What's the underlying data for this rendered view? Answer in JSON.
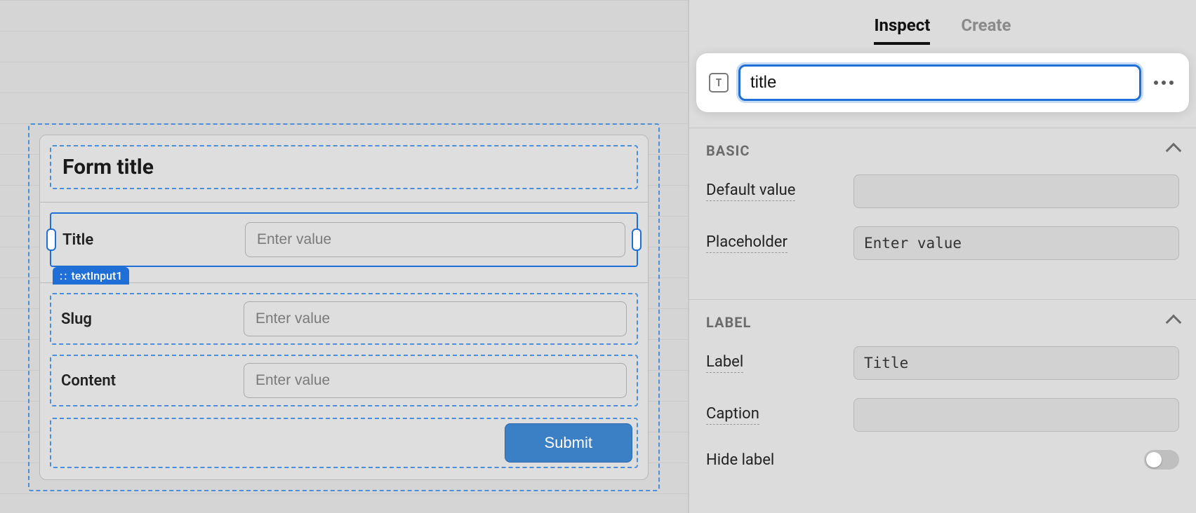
{
  "inspector": {
    "tabs": {
      "inspect": "Inspect",
      "create": "Create"
    },
    "component_name": "title",
    "type_icon_label": "T",
    "sections": {
      "basic": {
        "title": "BASIC",
        "default_value": {
          "label": "Default value",
          "value": ""
        },
        "placeholder": {
          "label": "Placeholder",
          "value": "Enter value"
        }
      },
      "label": {
        "title": "LABEL",
        "label": {
          "label": "Label",
          "value": "Title"
        },
        "caption": {
          "label": "Caption",
          "value": ""
        },
        "hide_label": {
          "label": "Hide label",
          "on": false
        }
      }
    }
  },
  "form": {
    "title": "Form title",
    "selected_tag": "textInput1",
    "fields": [
      {
        "label": "Title",
        "placeholder": "Enter value"
      },
      {
        "label": "Slug",
        "placeholder": "Enter value"
      },
      {
        "label": "Content",
        "placeholder": "Enter value"
      }
    ],
    "submit_label": "Submit"
  }
}
